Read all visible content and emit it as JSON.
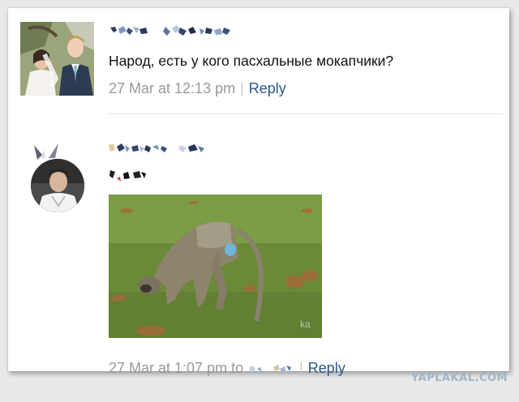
{
  "comments": [
    {
      "text": "Народ, есть у кого пасхальные мокапчики?",
      "time": "27 Mar at 12:13 pm",
      "separator": "|",
      "reply_label": "Reply"
    },
    {
      "time": "27 Mar at 1:07 pm to",
      "separator": "|",
      "reply_label": "Reply"
    }
  ],
  "watermark": "YAPLAKAL.COM",
  "colors": {
    "link": "#2a5885",
    "meta": "#999999",
    "text": "#111111",
    "watermark": "#9fb6c6"
  }
}
